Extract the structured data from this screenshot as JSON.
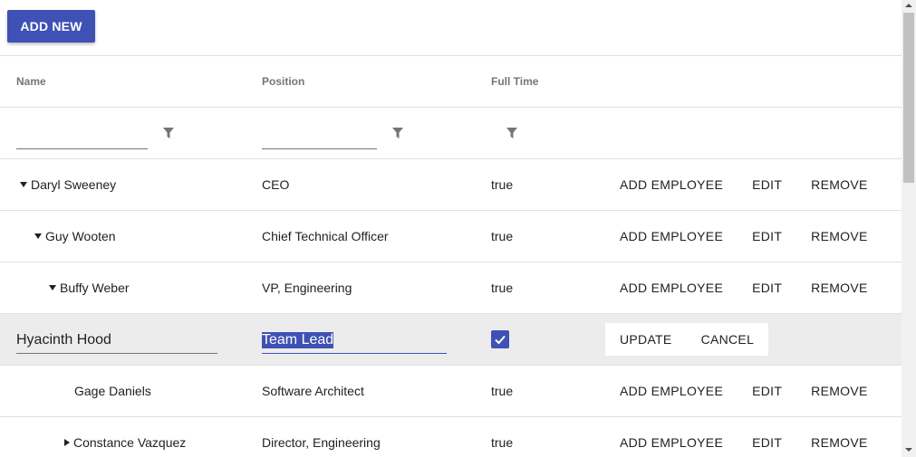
{
  "toolbar": {
    "add_new_label": "ADD NEW"
  },
  "columns": {
    "name": "Name",
    "position": "Position",
    "full_time": "Full Time"
  },
  "filters": {
    "name_value": "",
    "position_value": ""
  },
  "actions": {
    "add_employee": "ADD EMPLOYEE",
    "edit": "EDIT",
    "remove": "REMOVE",
    "update": "UPDATE",
    "cancel": "CANCEL"
  },
  "rows": [
    {
      "name": "Daryl Sweeney",
      "position": "CEO",
      "full_time": "true",
      "expander": "expanded"
    },
    {
      "name": "Guy Wooten",
      "position": "Chief Technical Officer",
      "full_time": "true",
      "expander": "expanded"
    },
    {
      "name": "Buffy Weber",
      "position": "VP, Engineering",
      "full_time": "true",
      "expander": "expanded"
    },
    {
      "name": "Hyacinth Hood",
      "position": "Team Lead",
      "full_time": true,
      "editing": true
    },
    {
      "name": "Gage Daniels",
      "position": "Software Architect",
      "full_time": "true",
      "expander": "none"
    },
    {
      "name": "Constance Vazquez",
      "position": "Director, Engineering",
      "full_time": "true",
      "expander": "collapsed"
    }
  ],
  "colors": {
    "primary": "#3f51b5",
    "edit_row_bg": "#ececec",
    "header_text": "#757575"
  }
}
